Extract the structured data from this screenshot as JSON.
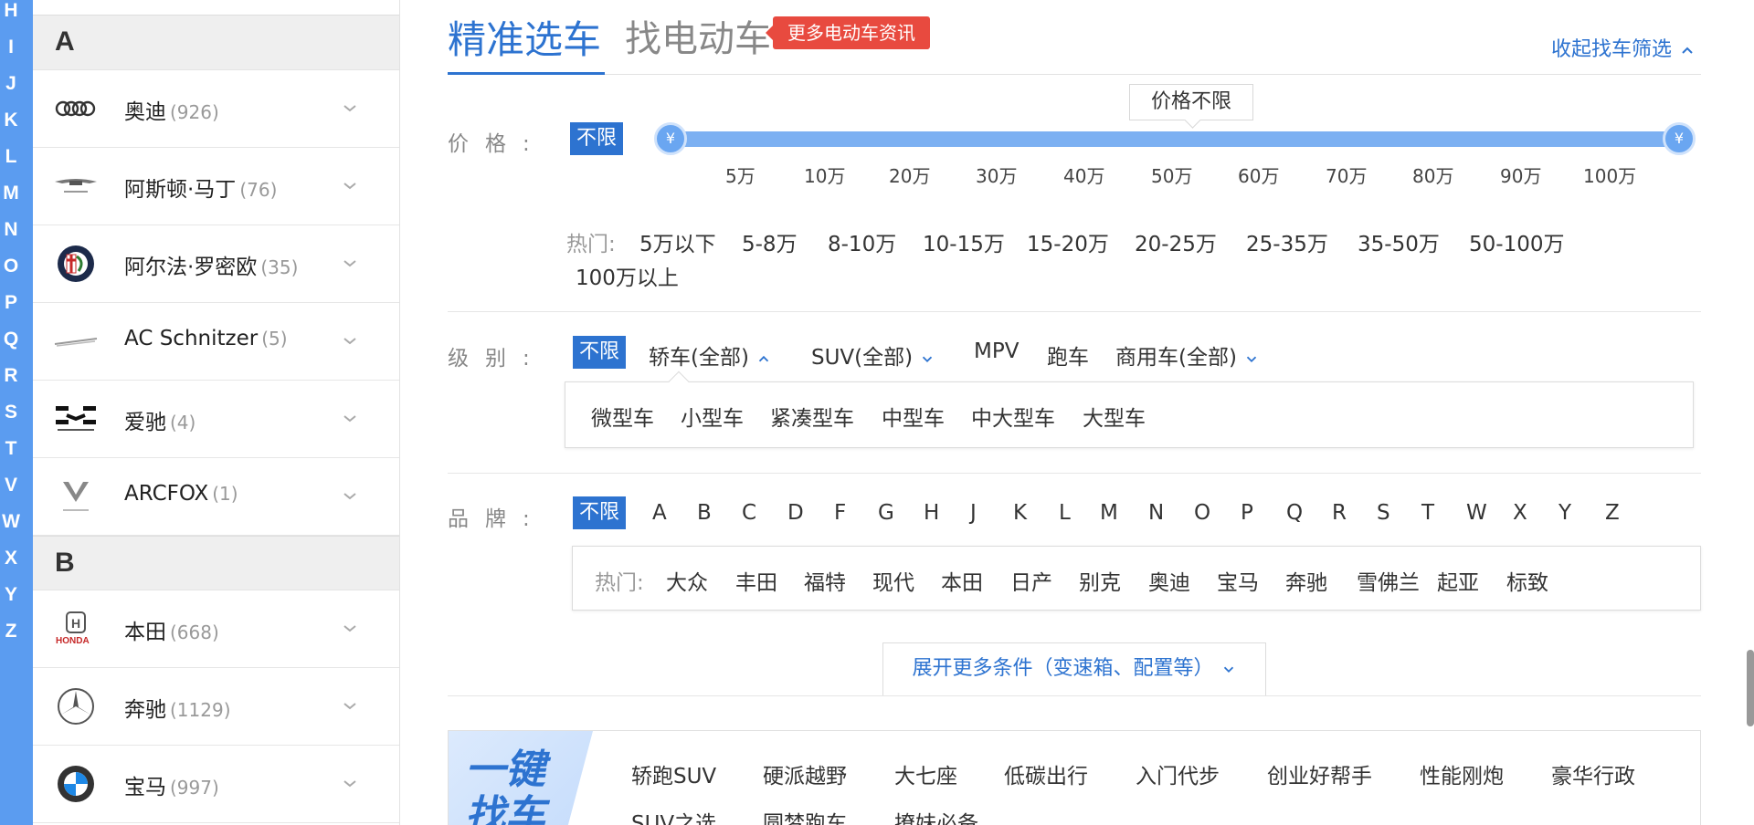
{
  "letter_rail": [
    "H",
    "I",
    "J",
    "K",
    "L",
    "M",
    "N",
    "O",
    "P",
    "Q",
    "R",
    "S",
    "T",
    "V",
    "W",
    "X",
    "Y",
    "Z"
  ],
  "brand_list": {
    "sections": [
      {
        "letter": "A",
        "brands": [
          {
            "name": "奥迪",
            "count": "(926)",
            "logo": "audi-logo"
          },
          {
            "name": "阿斯顿·马丁",
            "count": "(76)",
            "logo": "aston-martin-logo"
          },
          {
            "name": "阿尔法·罗密欧",
            "count": "(35)",
            "logo": "alfa-romeo-logo"
          },
          {
            "name": "AC Schnitzer",
            "count": "(5)",
            "logo": "ac-schnitzer-logo"
          },
          {
            "name": "爱驰",
            "count": "(4)",
            "logo": "aiways-logo"
          },
          {
            "name": "ARCFOX",
            "count": "(1)",
            "logo": "arcfox-logo"
          }
        ]
      },
      {
        "letter": "B",
        "brands": [
          {
            "name": "本田",
            "count": "(668)",
            "logo": "honda-logo"
          },
          {
            "name": "奔驰",
            "count": "(1129)",
            "logo": "mercedes-logo"
          },
          {
            "name": "宝马",
            "count": "(997)",
            "logo": "bmw-logo"
          }
        ]
      }
    ]
  },
  "tabs": {
    "active": "精准选车",
    "second": "找电动车",
    "badge": "更多电动车资讯",
    "collapse": "收起找车筛选"
  },
  "price": {
    "label": "价格:",
    "unlimited": "不限",
    "tooltip": "价格不限",
    "ticks": [
      "5万",
      "10万",
      "20万",
      "30万",
      "40万",
      "50万",
      "60万",
      "70万",
      "80万",
      "90万",
      "100万"
    ],
    "knob_symbol": "¥",
    "hot_label": "热门:",
    "hot": [
      "5万以下",
      "5-8万",
      "8-10万",
      "10-15万",
      "15-20万",
      "20-25万",
      "25-35万",
      "35-50万",
      "50-100万",
      "100万以上"
    ]
  },
  "level": {
    "label": "级别:",
    "unlimited": "不限",
    "options": [
      "轿车(全部)",
      "SUV(全部)",
      "MPV",
      "跑车",
      "商用车(全部)"
    ],
    "sub_options": [
      "微型车",
      "小型车",
      "紧凑型车",
      "中型车",
      "中大型车",
      "大型车"
    ]
  },
  "brand_filter": {
    "label": "品牌:",
    "unlimited": "不限",
    "letters": [
      "A",
      "B",
      "C",
      "D",
      "F",
      "G",
      "H",
      "J",
      "K",
      "L",
      "M",
      "N",
      "O",
      "P",
      "Q",
      "R",
      "S",
      "T",
      "W",
      "X",
      "Y",
      "Z"
    ],
    "hot_label": "热门:",
    "hot": [
      "大众",
      "丰田",
      "福特",
      "现代",
      "本田",
      "日产",
      "别克",
      "奥迪",
      "宝马",
      "奔驰",
      "雪佛兰",
      "起亚",
      "标致"
    ]
  },
  "expand": "展开更多条件（变速箱、配置等）",
  "quick_find": {
    "banner": "一键找车",
    "items": [
      "轿跑SUV",
      "硬派越野",
      "大七座",
      "低碳出行",
      "入门代步",
      "创业好帮手",
      "性能刚炮",
      "豪华行政",
      "SUV之选",
      "圆梦跑车",
      "撩妹必备"
    ]
  },
  "colors": {
    "accent": "#2d73d0",
    "rail": "#5b9cf0",
    "badge": "#e84a3f"
  }
}
